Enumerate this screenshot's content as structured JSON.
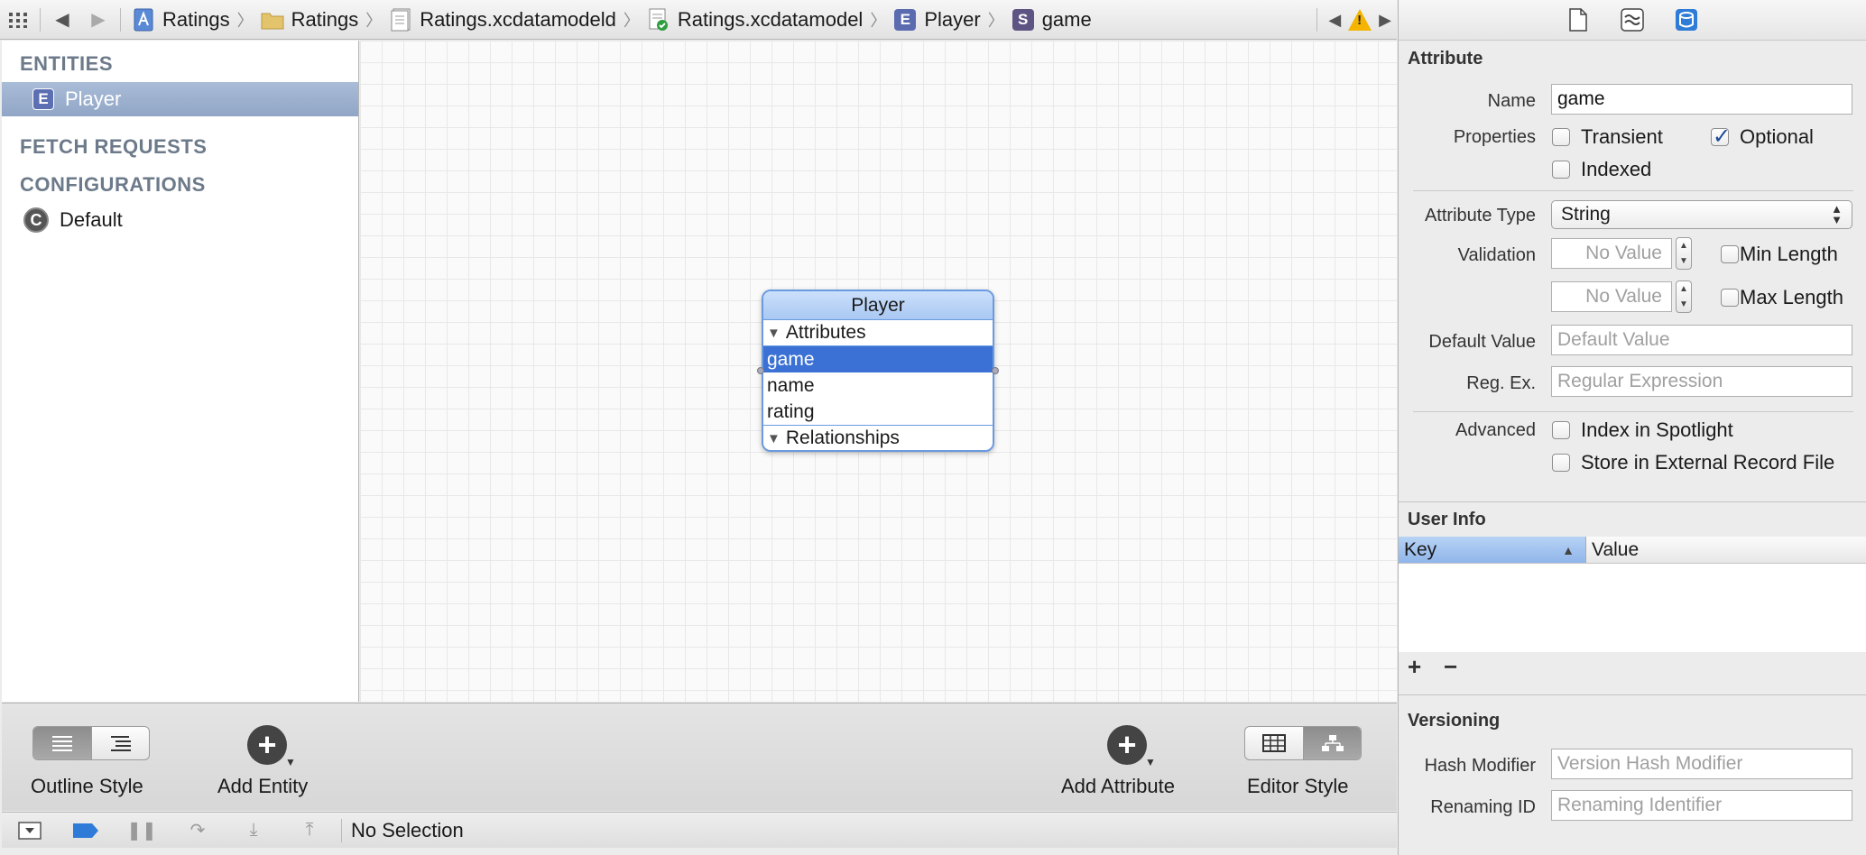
{
  "jump_bar": {
    "crumbs": [
      {
        "label": "Ratings",
        "icon": "project-icon"
      },
      {
        "label": "Ratings",
        "icon": "folder-icon"
      },
      {
        "label": "Ratings.xcdatamodeld",
        "icon": "datamodel-bundle-icon"
      },
      {
        "label": "Ratings.xcdatamodel",
        "icon": "datamodel-version-icon"
      },
      {
        "label": "Player",
        "icon": "entity-icon",
        "badge": "E"
      },
      {
        "label": "game",
        "icon": "string-attribute-icon",
        "badge": "S"
      }
    ]
  },
  "outline": {
    "entities_header": "ENTITIES",
    "entities": [
      {
        "label": "Player",
        "badge": "E",
        "selected": true
      }
    ],
    "fetch_requests_header": "FETCH REQUESTS",
    "configurations_header": "CONFIGURATIONS",
    "configurations": [
      {
        "label": "Default",
        "badge": "C"
      }
    ]
  },
  "diagram": {
    "entity_name": "Player",
    "attributes_header": "Attributes",
    "attributes": [
      "game",
      "name",
      "rating"
    ],
    "selected_attribute": "game",
    "relationships_header": "Relationships"
  },
  "editor_bar": {
    "outline_style_label": "Outline Style",
    "add_entity_label": "Add Entity",
    "add_attribute_label": "Add Attribute",
    "editor_style_label": "Editor Style",
    "add_symbol": "+"
  },
  "debug_bar": {
    "status": "No Selection"
  },
  "inspector": {
    "attribute_title": "Attribute",
    "name_label": "Name",
    "name_value": "game",
    "properties_label": "Properties",
    "transient_label": "Transient",
    "transient_checked": false,
    "optional_label": "Optional",
    "optional_checked": true,
    "indexed_label": "Indexed",
    "indexed_checked": false,
    "attribute_type_label": "Attribute Type",
    "attribute_type_value": "String",
    "validation_label": "Validation",
    "min_placeholder": "No Value",
    "max_placeholder": "No Value",
    "min_length_label": "Min Length",
    "max_length_label": "Max Length",
    "default_value_label": "Default Value",
    "default_value_placeholder": "Default Value",
    "regex_label": "Reg. Ex.",
    "regex_placeholder": "Regular Expression",
    "advanced_label": "Advanced",
    "index_spotlight_label": "Index in Spotlight",
    "store_external_label": "Store in External Record File",
    "user_info_title": "User Info",
    "key_header": "Key",
    "value_header": "Value",
    "add_symbol": "+",
    "remove_symbol": "−",
    "versioning_title": "Versioning",
    "hash_modifier_label": "Hash Modifier",
    "hash_modifier_placeholder": "Version Hash Modifier",
    "renaming_id_label": "Renaming ID",
    "renaming_id_placeholder": "Renaming Identifier"
  },
  "colors": {
    "selection_blue": "#3b71d4",
    "outline_selection": "#9fb2cf",
    "warning": "#f4b400"
  }
}
